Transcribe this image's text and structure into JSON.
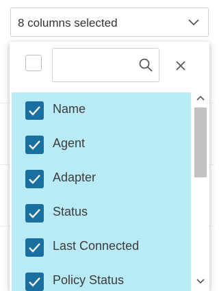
{
  "select": {
    "label": "8 columns selected",
    "icon": "chevron-down-icon"
  },
  "search": {
    "value": "",
    "placeholder": "",
    "icon": "search-icon",
    "clear_icon": "close-icon"
  },
  "columns": [
    {
      "label": "Name",
      "checked": true
    },
    {
      "label": "Agent",
      "checked": true
    },
    {
      "label": "Adapter",
      "checked": true
    },
    {
      "label": "Status",
      "checked": true
    },
    {
      "label": "Last Connected",
      "checked": true
    },
    {
      "label": "Policy Status",
      "checked": true
    }
  ],
  "colors": {
    "selected_row_bg": "#b9ebf6",
    "checkbox_fill": "#1a6fa1",
    "border": "#cfcfcf",
    "scroll_thumb": "#c1c1c1"
  }
}
